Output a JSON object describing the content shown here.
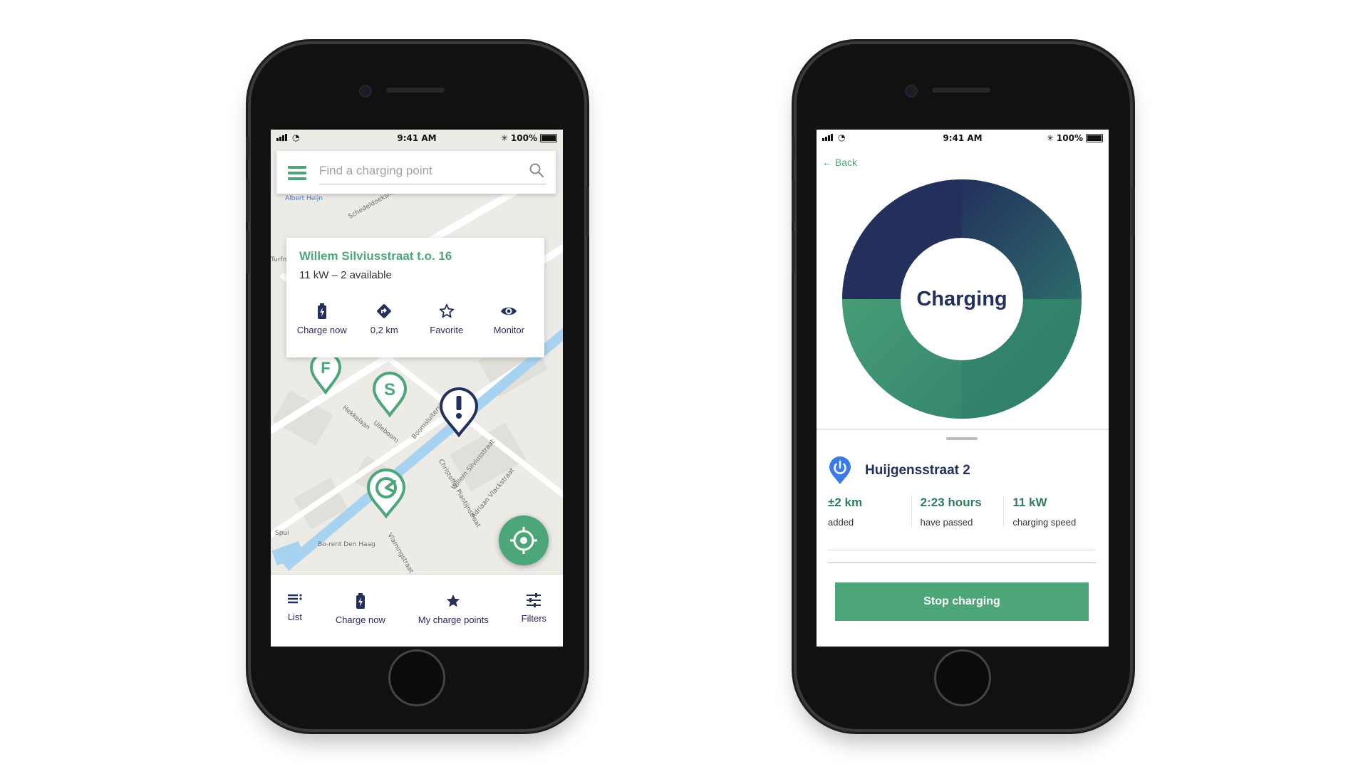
{
  "status_bar": {
    "time": "9:41 AM",
    "battery": "100%"
  },
  "left_phone": {
    "search": {
      "placeholder": "Find a charging point"
    },
    "popup": {
      "title": "Willem Silviusstraat t.o. 16",
      "subtitle": "11 kW – 2 available",
      "actions": [
        {
          "label": "Charge now",
          "icon": "battery-charge-icon"
        },
        {
          "label": "0,2 km",
          "icon": "directions-icon"
        },
        {
          "label": "Favorite",
          "icon": "star-outline-icon"
        },
        {
          "label": "Monitor",
          "icon": "eye-icon"
        }
      ]
    },
    "map_labels": [
      "Albert Heijn",
      "Schedeldoekshaven",
      "Bo-rent Den Haag",
      "Spui",
      "Hekkelaan",
      "Boomsluiterskade",
      "Uileboom",
      "Willem Silviusstraat",
      "Christoffel Plantijnstraat",
      "Adriaan Vlackstraat",
      "Vlamingstraat",
      "Turfmarkt"
    ],
    "pins": [
      {
        "letter": "F",
        "color": "#4da67a"
      },
      {
        "letter": "S",
        "color": "#4da67a"
      },
      {
        "letter": "!",
        "color": "#23305c"
      },
      {
        "letter": "plug",
        "color": "#4da67a"
      }
    ],
    "tabs": [
      {
        "label": "List",
        "icon": "list-icon"
      },
      {
        "label": "Charge now",
        "icon": "battery-charge-icon"
      },
      {
        "label": "My charge points",
        "icon": "star-icon"
      },
      {
        "label": "Filters",
        "icon": "filters-icon"
      }
    ]
  },
  "right_phone": {
    "back_label": "Back",
    "donut": {
      "center_label": "Charging",
      "colors": [
        "#23305c",
        "#2d6b6a",
        "#4da67a"
      ]
    },
    "location": "Huijgensstraat 2",
    "stats": [
      {
        "value": "±2 km",
        "label": "added"
      },
      {
        "value": "2:23 hours",
        "label": "have passed"
      },
      {
        "value": "11 kW",
        "label": "charging speed"
      }
    ],
    "stop_button": "Stop charging"
  },
  "colors": {
    "accent_green": "#4da67a",
    "navy": "#23305c",
    "pin_blue": "#3b7be8"
  }
}
